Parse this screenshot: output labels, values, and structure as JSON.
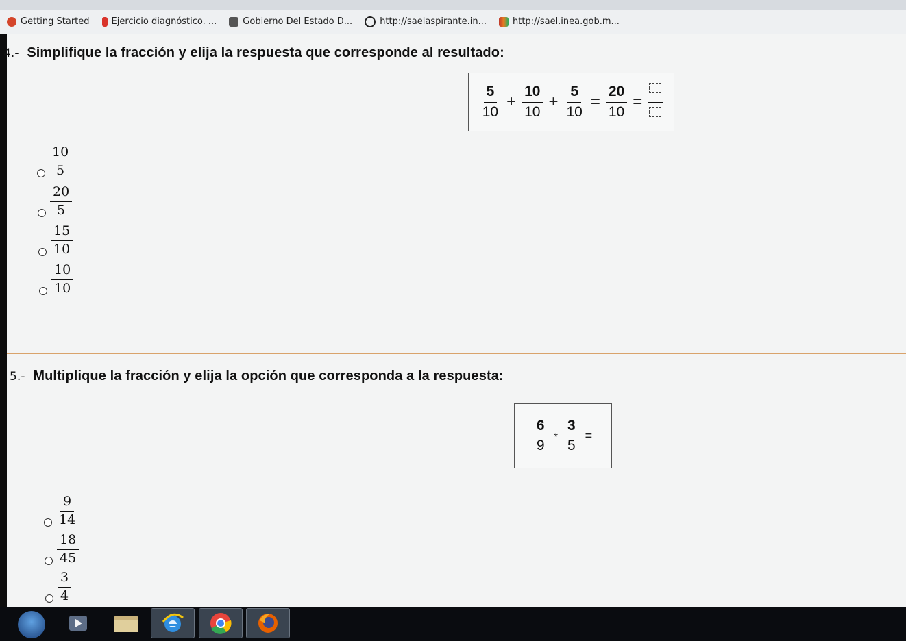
{
  "bookmarks": [
    {
      "label": "Getting Started",
      "icon": "firefox-icon",
      "color": "#d4452a"
    },
    {
      "label": "Ejercicio diagnóstico. ...",
      "icon": "flag-icon",
      "color": "#d9342b"
    },
    {
      "label": "Gobierno Del Estado D...",
      "icon": "building-icon",
      "color": "#555555"
    },
    {
      "label": "http://saelaspirante.in...",
      "icon": "globe-icon",
      "color": "#222222"
    },
    {
      "label": "http://sael.inea.gob.m...",
      "icon": "sael-icon",
      "color": "#c0392b"
    }
  ],
  "question4": {
    "number": "4.-",
    "text": "Simplifique la fracción y elija la respuesta que corresponde al resultado:",
    "equation": [
      {
        "num": "5",
        "den": "10"
      },
      {
        "op": "+"
      },
      {
        "num": "10",
        "den": "10"
      },
      {
        "op": "+"
      },
      {
        "num": "5",
        "den": "10"
      },
      {
        "op": "="
      },
      {
        "num": "20",
        "den": "10"
      },
      {
        "op": "="
      }
    ],
    "options": [
      {
        "num": "10",
        "den": "5"
      },
      {
        "num": "20",
        "den": "5"
      },
      {
        "num": "15",
        "den": "10"
      },
      {
        "num": "10",
        "den": "10"
      }
    ]
  },
  "question5": {
    "number": "5.-",
    "text": "Multiplique la fracción y elija la opción que corresponda a la respuesta:",
    "equation": [
      {
        "num": "6",
        "den": "9"
      },
      {
        "op": "*"
      },
      {
        "num": "3",
        "den": "5"
      },
      {
        "op": "="
      }
    ],
    "options": [
      {
        "num": "9",
        "den": "14"
      },
      {
        "num": "18",
        "den": "45"
      },
      {
        "num": "3",
        "den": "4"
      }
    ]
  },
  "taskbar": {
    "items": [
      "start-button",
      "media-player-icon",
      "file-explorer-icon",
      "internet-explorer-icon",
      "chrome-icon",
      "firefox-icon"
    ]
  }
}
